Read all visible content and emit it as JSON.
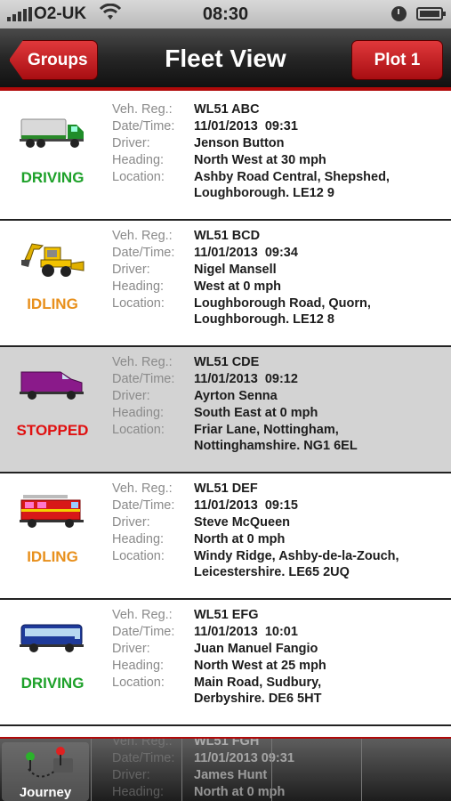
{
  "status_bar": {
    "carrier": "O2-UK",
    "time": "08:30"
  },
  "nav": {
    "back_label": "Groups",
    "title": "Fleet View",
    "plot_label": "Plot 1"
  },
  "labels": {
    "reg": "Veh. Reg.:",
    "datetime": "Date/Time:",
    "driver": "Driver:",
    "heading": "Heading:",
    "location": "Location:"
  },
  "colors": {
    "driving": "#1ea12a",
    "idling": "#e8901c",
    "stopped": "#e01010",
    "accent": "#b00a0a"
  },
  "vehicles": [
    {
      "icon": "truck-icon",
      "status": "DRIVING",
      "reg": "WL51 ABC",
      "datetime": "11/01/2013  09:31",
      "driver": "Jenson Button",
      "heading": "North West at 30 mph",
      "location_line1": "Ashby Road Central, Shepshed,",
      "location_line2": "Loughborough. LE12 9"
    },
    {
      "icon": "digger-icon",
      "status": "IDLING",
      "reg": "WL51 BCD",
      "datetime": "11/01/2013  09:34",
      "driver": "Nigel Mansell",
      "heading": "West at 0 mph",
      "location_line1": "Loughborough Road, Quorn,",
      "location_line2": "Loughborough. LE12 8"
    },
    {
      "icon": "van-icon",
      "status": "STOPPED",
      "reg": "WL51 CDE",
      "datetime": "11/01/2013  09:12",
      "driver": "Ayrton Senna",
      "heading": "South East at 0 mph",
      "location_line1": "Friar Lane, Nottingham,",
      "location_line2": "Nottinghamshire. NG1 6EL"
    },
    {
      "icon": "fire-engine-icon",
      "status": "IDLING",
      "reg": "WL51 DEF",
      "datetime": "11/01/2013  09:15",
      "driver": "Steve McQueen",
      "heading": "North at 0 mph",
      "location_line1": "Windy Ridge, Ashby-de-la-Zouch,",
      "location_line2": "Leicestershire. LE65 2UQ"
    },
    {
      "icon": "bus-icon",
      "status": "DRIVING",
      "reg": "WL51 EFG",
      "datetime": "11/01/2013  10:01",
      "driver": "Juan Manuel Fangio",
      "heading": "North West at 25 mph",
      "location_line1": "Main Road, Sudbury,",
      "location_line2": "Derbyshire. DE6 5HT"
    }
  ],
  "partial_row": {
    "reg": "WL51 FGH",
    "datetime": "11/01/2013  09:31",
    "driver": "James Hunt",
    "heading": "North at 0 mph"
  },
  "tabbar": {
    "journey_label": "Journey"
  }
}
